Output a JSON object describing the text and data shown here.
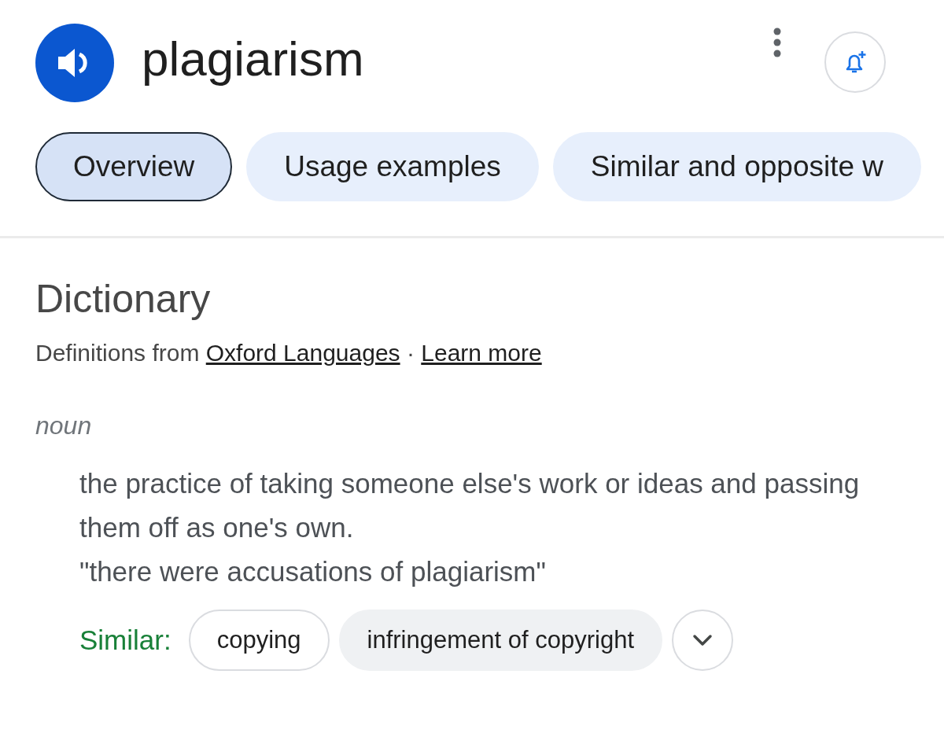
{
  "header": {
    "word": "plagiarism"
  },
  "tabs": [
    {
      "label": "Overview",
      "selected": true
    },
    {
      "label": "Usage examples",
      "selected": false
    },
    {
      "label": "Similar and opposite w",
      "selected": false
    }
  ],
  "dictionary": {
    "title": "Dictionary",
    "source_prefix": "Definitions from ",
    "source_link": "Oxford Languages",
    "separator": " · ",
    "learn_more": "Learn more",
    "part_of_speech": "noun",
    "definition": "the practice of taking someone else's work or ideas and passing them off as one's own.",
    "example": "\"there were accusations of plagiarism\"",
    "similar_label": "Similar:",
    "similar": [
      {
        "label": "copying",
        "kind": "outlined"
      },
      {
        "label": "infringement of copyright",
        "kind": "filled"
      }
    ]
  }
}
